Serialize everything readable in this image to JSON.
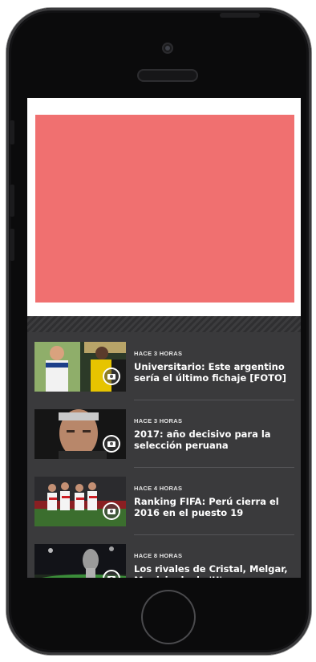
{
  "colors": {
    "ad_placeholder": "#f07070",
    "feed_background": "#3a3a3c",
    "headline_text": "#ffffff"
  },
  "ad": {
    "label": ""
  },
  "news": [
    {
      "time": "HACE 3 HORAS",
      "title": "Universitario: Este argentino sería el último fichaje [FOTO]",
      "icon": "camera-icon"
    },
    {
      "time": "HACE 3 HORAS",
      "title": "2017: año decisivo para la selección peruana",
      "icon": "camera-icon"
    },
    {
      "time": "HACE 4 HORAS",
      "title": "Ranking FIFA: Perú cierra el 2016 en el puesto 19",
      "icon": "camera-icon"
    },
    {
      "time": "HACE 8 HORAS",
      "title": "Los rivales de Cristal, Melgar, Municipal y la 'U'",
      "icon": "camera-icon"
    }
  ]
}
